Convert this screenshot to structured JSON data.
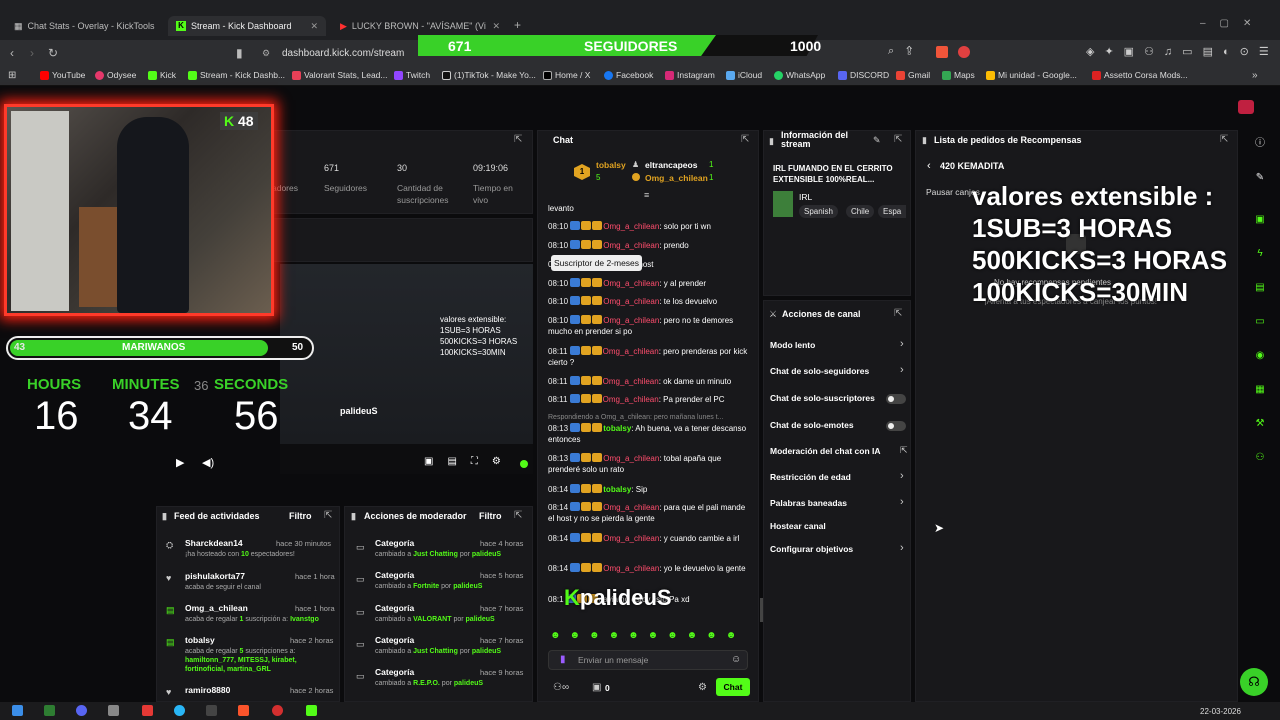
{
  "browser": {
    "tabs": [
      "Chat Stats - Overlay - KickTools",
      "Stream - Kick Dashboard",
      "LUCKY BROWN - \"AVÍSAME\" (Vi"
    ],
    "url": "dashboard.kick.com/stream",
    "bookmarks": [
      "YouTube",
      "Odysee",
      "Kick",
      "Stream - Kick Dashb...",
      "Valorant Stats, Lead...",
      "Twitch",
      "(1)TikTok - Make Yo...",
      "Home / X",
      "Facebook",
      "Instagram",
      "iCloud",
      "WhatsApp",
      "DISCORD",
      "Gmail",
      "Maps",
      "Mi unidad - Google...",
      "Assetto Corsa Mods..."
    ]
  },
  "followers": {
    "current": "671",
    "label": "SEGUIDORES",
    "goal": "1000"
  },
  "webcam": {
    "badge": "48"
  },
  "goal": {
    "current": "43",
    "label": "MARIWANOS",
    "target": "50",
    "progress": 0.86
  },
  "timer": {
    "hours_label": "HOURS",
    "minutes_label": "MINUTES",
    "seconds_label": "SECONDS",
    "hours": "16",
    "minutes": "34",
    "seconds": "56",
    "overlap": "36"
  },
  "stats": {
    "viewers_label": "adores",
    "followers": "671",
    "followers_label": "Seguidores",
    "subs": "30",
    "subs_label": "Cantidad de suscripciones",
    "time": "09:19:06",
    "time_label": "Tiempo en vivo"
  },
  "preview": {
    "overlay_text": [
      "valores extensible:",
      "1SUB=3 HORAS",
      "500KICKS=3 HORAS",
      "100KICKS=30MIN"
    ],
    "watermark": "palideuS"
  },
  "feed": {
    "title": "Feed de actividades",
    "filter": "Filtro",
    "items": [
      {
        "name": "Sharckdean14",
        "time": "hace 30 minutos",
        "sub_pre": "¡ha hosteado con ",
        "count": "10",
        "sub_post": " espectadores!"
      },
      {
        "name": "pishulakorta77",
        "time": "hace 1 hora",
        "sub_pre": "acaba de seguir el canal",
        "count": "",
        "sub_post": ""
      },
      {
        "name": "Omg_a_chilean",
        "time": "hace 1 hora",
        "sub_pre": "acaba de regalar ",
        "count": "1",
        "sub_post": " suscripción a: ",
        "target": "Ivanstgo"
      },
      {
        "name": "tobalsy",
        "time": "hace 2 horas",
        "sub_pre": "acaba de regalar ",
        "count": "5",
        "sub_post": " suscripciones a:",
        "list": "hamiltonn_777, MITESSJ, kirabet, fortinoficial, martina_GRL"
      },
      {
        "name": "ramiro8880",
        "time": "hace 2 horas"
      }
    ]
  },
  "modactions": {
    "title": "Acciones de moderador",
    "filter": "Filtro",
    "items": [
      {
        "name": "Categoría",
        "time": "hace 4 horas",
        "game": "Just Chatting",
        "by": "palideuS"
      },
      {
        "name": "Categoría",
        "time": "hace 5 horas",
        "game": "Fortnite",
        "by": "palideuS"
      },
      {
        "name": "Categoría",
        "time": "hace 7 horas",
        "game": "VALORANT",
        "by": "palideuS"
      },
      {
        "name": "Categoría",
        "time": "hace 7 horas",
        "game": "Just Chatting",
        "by": "palideuS"
      },
      {
        "name": "Categoría",
        "time": "hace 9 horas",
        "game": "R.E.P.O.",
        "by": "palideuS"
      }
    ],
    "changed": "cambiado a ",
    "por": " por "
  },
  "chat": {
    "title": "Chat",
    "pinned": {
      "user1": "tobalsy",
      "count1": "5",
      "user2": "eltrancapeos",
      "n2": "1",
      "user3": "Omg_a_chilean",
      "n3": "1"
    },
    "tooltip": "Suscriptor de 2-meses",
    "first_line": "levanto",
    "messages": [
      {
        "time": "08:10",
        "user": "Omg_a_chilean",
        "text": "solo por ti wn"
      },
      {
        "time": "08:10",
        "user": "Omg_a_chilean",
        "text": "prendo"
      },
      {
        "time": "08:10",
        "user": "",
        "text": "manda el host"
      },
      {
        "time": "08:10",
        "user": "Omg_a_chilean",
        "text": "y al prender"
      },
      {
        "time": "08:10",
        "user": "Omg_a_chilean",
        "text": "te los devuelvo"
      },
      {
        "time": "08:10",
        "user": "Omg_a_chilean",
        "text": "pero no te demores mucho en prender si po"
      },
      {
        "time": "08:11",
        "user": "Omg_a_chilean",
        "text": "pero prenderas por kick cierto ?"
      },
      {
        "time": "08:11",
        "user": "Omg_a_chilean",
        "text": "ok dame un minuto"
      },
      {
        "time": "08:11",
        "user": "Omg_a_chilean",
        "text": "Pa prender el PC"
      },
      {
        "time": "08:13",
        "user": "tobalsy",
        "text": "Ah buena, va a tener descanso entonces",
        "reply": "Respondiendo a Omg_a_chilean: pero mañana lunes t..."
      },
      {
        "time": "08:13",
        "user": "Omg_a_chilean",
        "text": "tobal apaña que prenderé solo un rato"
      },
      {
        "time": "08:14",
        "user": "tobalsy",
        "text": "Sip"
      },
      {
        "time": "08:14",
        "user": "Omg_a_chilean",
        "text": "para que el pali mande el host y no se pierda la gente"
      },
      {
        "time": "08:14",
        "user": "Omg_a_chilean",
        "text": "y cuando cambie a irl"
      },
      {
        "time": "08:14",
        "user": "Omg_a_chilean",
        "text": "yo le devuelvo la gente"
      },
      {
        "time": "08:1",
        "user": "",
        "text": "davia no estoy listo Pa xd"
      }
    ],
    "watermark": "palideuS",
    "input_placeholder": "Enviar un mensaje",
    "points": "0",
    "send": "Chat"
  },
  "info": {
    "title": "Información del stream",
    "stream_title": "IRL FUMANDO EN EL CERRITO EXTENSIBLE 100%REAL...",
    "category": "IRL",
    "tags": [
      "Spanish",
      "Chile",
      "Espa"
    ]
  },
  "channel_actions": {
    "title": "Acciones de canal",
    "items": [
      "Modo lento",
      "Chat de solo-seguidores",
      "Chat de solo-suscriptores",
      "Chat de solo-emotes",
      "Moderación del chat con IA",
      "Restricción de edad",
      "Palabras baneadas",
      "Hostear canal",
      "Configurar objetivos"
    ]
  },
  "rewards": {
    "title": "Lista de pedidos de Recompensas",
    "back_label": "420 KEMADITA",
    "pause": "Pausar canjes",
    "empty1": "No hay recompensas pendientes",
    "empty2": "¡Alienta a tus espectadores a canjear los puntos!"
  },
  "overlay_big": [
    "valores extensible :",
    "1SUB=3 HORAS",
    "500KICKS=3 HORAS",
    "100KICKS=30MIN"
  ],
  "taskbar": {
    "date": "22-03-2026"
  },
  "colors": {
    "kick_green": "#53fc18",
    "cam_border": "#ff3a2a",
    "chat_user": "#ff4d6d"
  }
}
